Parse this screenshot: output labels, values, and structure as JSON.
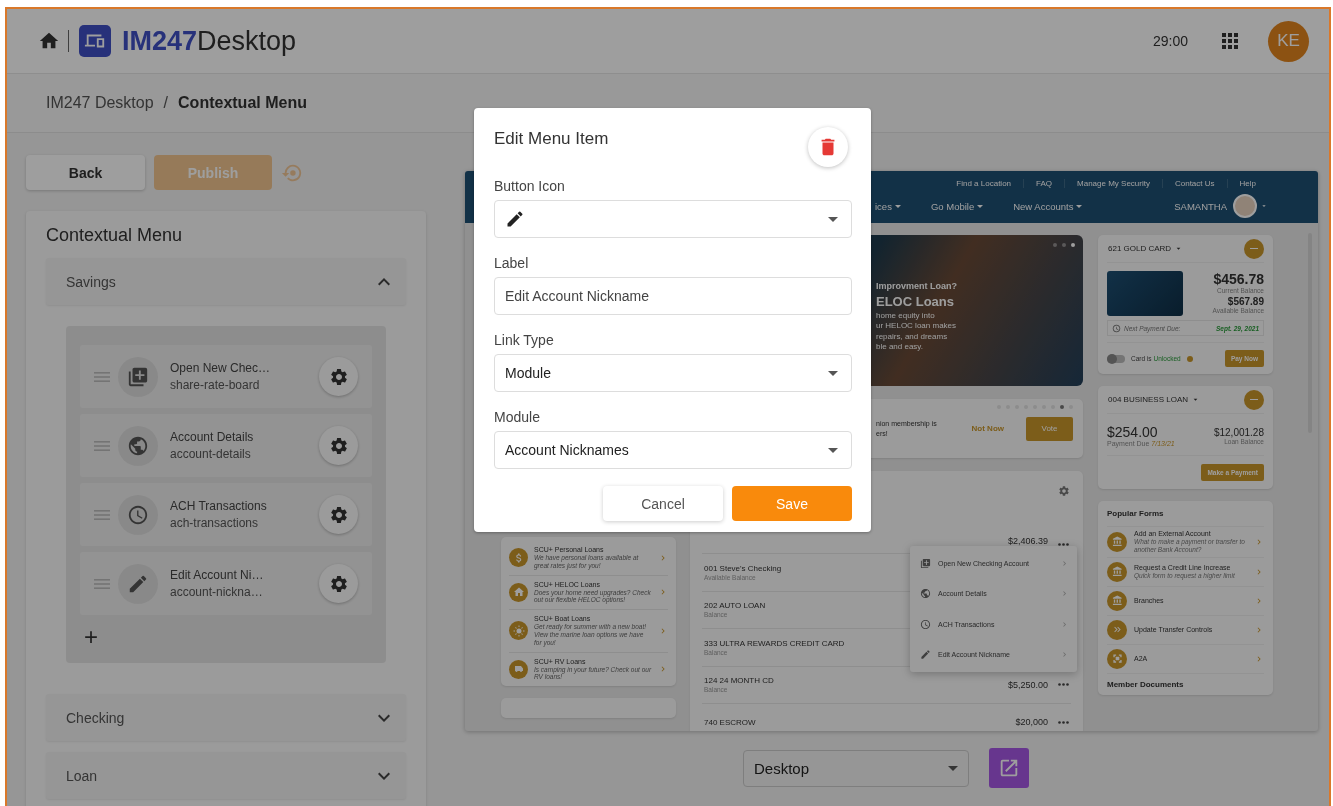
{
  "app_header": {
    "brand_prefix": "IM247",
    "brand_suffix": "Desktop",
    "timer": "29:00",
    "avatar_initials": "KE"
  },
  "breadcrumb": {
    "items": [
      "IM247 Desktop",
      "Contextual Menu"
    ],
    "separator": "/"
  },
  "toolbar": {
    "back_button": "Back",
    "publish_button": {
      "label": "Publish",
      "disabled": true
    }
  },
  "menu_panel": {
    "title": "Contextual Menu",
    "sections": [
      {
        "label": "Savings",
        "expanded": true,
        "items": [
          {
            "title": "Open New Chec…",
            "slug": "share-rate-board"
          },
          {
            "title": "Account Details",
            "slug": "account-details"
          },
          {
            "title": "ACH Transactions",
            "slug": "ach-transactions"
          },
          {
            "title": "Edit Account Ni…",
            "slug": "account-nickna…"
          }
        ],
        "add_button": "+"
      },
      {
        "label": "Checking",
        "expanded": false
      },
      {
        "label": "Loan",
        "expanded": false
      }
    ]
  },
  "preview": {
    "top_links": [
      "Find a Location",
      "FAQ",
      "Manage My Security",
      "Contact Us",
      "Help"
    ],
    "nav_items": [
      "ices",
      "Go Mobile",
      "New Accounts"
    ],
    "user_name": "SAMANTHA",
    "banner": {
      "lines": [
        "Improvment Loan?",
        "ELOC Loans",
        "home equity into",
        "ur HELOC loan makes",
        "repairs, and dreams",
        "ble and easy."
      ],
      "dots": [
        {
          "selected": false
        },
        {
          "selected": false
        },
        {
          "selected": true
        }
      ]
    },
    "vote_card": {
      "lines": [
        "nion membership is",
        "ers!"
      ],
      "dismiss_button": "Not Now",
      "vote_button": "Vote",
      "dots": [
        {
          "selected": false
        },
        {
          "selected": false
        },
        {
          "selected": false
        },
        {
          "selected": false
        },
        {
          "selected": false
        },
        {
          "selected": false
        },
        {
          "selected": false
        },
        {
          "selected": true
        },
        {
          "selected": false
        }
      ]
    },
    "products": [
      {
        "title": "SCU+ Personal Loans",
        "description": "We have personal loans available at great rates just for you!"
      },
      {
        "title": "SCU+ HELOC Loans",
        "description": "Does your home need upgrades? Check out our flexible HELOC options!"
      },
      {
        "title": "SCU+ Boat Loans",
        "description": "Get ready for summer with a new boat! View the marine loan options we have for you!"
      },
      {
        "title": "SCU+ RV Loans",
        "description": "Is camping in your future? Check out our RV loans!"
      }
    ],
    "accounts": [
      {
        "amount": "$2,406.39"
      },
      {
        "name": "001 Steve's Checking",
        "note": "Available Balance"
      },
      {
        "name": "202 AUTO LOAN",
        "note": "Balance"
      },
      {
        "name": "333 ULTRA REWARDS CREDIT CARD",
        "note": "Balance"
      },
      {
        "name": "124 24 MONTH CD",
        "note": "Balance",
        "amount": "$5,250.00"
      },
      {
        "name": "740 ESCROW",
        "amount": "$20,000"
      }
    ],
    "context_menu": [
      "Open New Checking Account",
      "Account Details",
      "ACH Transactions",
      "Edit Account Nickname"
    ],
    "gold_card": {
      "title": "621 GOLD CARD",
      "current_balance": "$456.78",
      "current_label": "Current Balance",
      "available_balance": "$567.89",
      "available_label": "Available Balance",
      "due_label": "Next Payment Due:",
      "due_date": "Sept. 29, 2021",
      "lock_toggle": {
        "on": false
      },
      "status_prefix": "Card is",
      "status": "Unlocked",
      "pay_button": "Pay Now"
    },
    "loan_card": {
      "title": "004 BUSINESS LOAN",
      "payment": "$254.00",
      "due_prefix": "Payment Due",
      "due_date": "7/13/21",
      "balance": "$12,001.28",
      "balance_label": "Loan Balance",
      "pay_button": "Make a Payment"
    },
    "popular_forms": {
      "title": "Popular Forms",
      "items": [
        {
          "title": "Add an External Account",
          "description": "What to make a payment or transfer to another Bank Account?"
        },
        {
          "title": "Request a Credit Line Increase",
          "description": "Quick form to request a higher limit"
        },
        {
          "title": "Branches"
        },
        {
          "title": "Update Transfer Controls"
        },
        {
          "title": "A2A"
        }
      ]
    },
    "member_documents": "Member Documents"
  },
  "device_select": {
    "value": "Desktop"
  },
  "modal": {
    "title": "Edit Menu Item",
    "fields": [
      {
        "kind": "icon-select",
        "label": "Button Icon"
      },
      {
        "kind": "input",
        "label": "Label",
        "value": "Edit Account Nickname"
      },
      {
        "kind": "select",
        "label": "Link Type",
        "value": "Module"
      },
      {
        "kind": "select",
        "label": "Module",
        "value": "Account Nicknames"
      }
    ],
    "buttons": [
      {
        "kind": "secondary",
        "label": "Cancel"
      },
      {
        "kind": "primary",
        "label": "Save"
      }
    ]
  }
}
